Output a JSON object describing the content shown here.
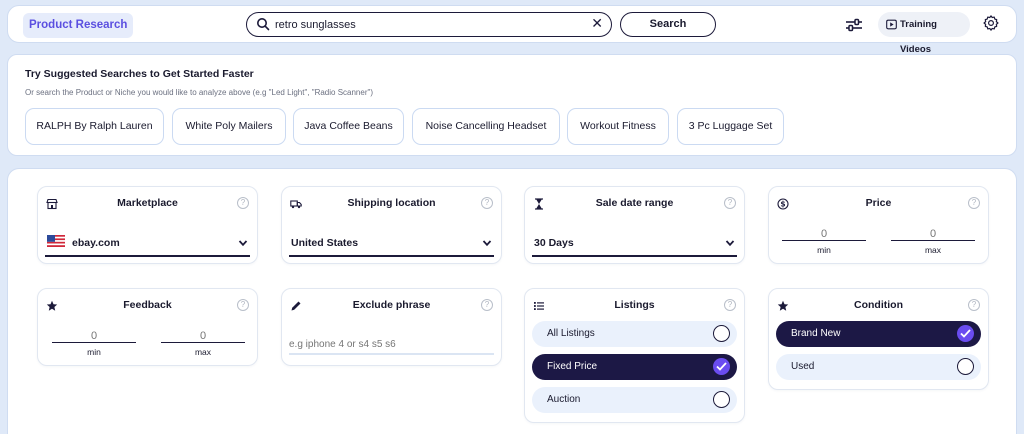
{
  "topbar": {
    "brand": "Product Research",
    "search_value": "retro sunglasses",
    "search_button": "Search",
    "training_videos": "Training Videos"
  },
  "suggested": {
    "title": "Try Suggested Searches to Get Started Faster",
    "subtitle": "Or search the Product or Niche you would like to analyze above (e.g \"Led Light\", \"Radio Scanner\")",
    "chips": [
      "RALPH By Ralph Lauren",
      "White Poly Mailers",
      "Java Coffee Beans",
      "Noise Cancelling Headset",
      "Workout Fitness",
      "3 Pc Luggage Set"
    ]
  },
  "filters": {
    "marketplace": {
      "title": "Marketplace",
      "value": "ebay.com"
    },
    "shipping": {
      "title": "Shipping location",
      "value": "United States"
    },
    "sale_date": {
      "title": "Sale date range",
      "value": "30 Days"
    },
    "price": {
      "title": "Price",
      "min_placeholder": "0",
      "max_placeholder": "0",
      "min_label": "min",
      "max_label": "max"
    },
    "feedback": {
      "title": "Feedback",
      "min_placeholder": "0",
      "max_placeholder": "0",
      "min_label": "min",
      "max_label": "max"
    },
    "exclude": {
      "title": "Exclude phrase",
      "placeholder": "e.g iphone 4 or s4 s5 s6"
    },
    "listings": {
      "title": "Listings",
      "options": [
        "All Listings",
        "Fixed Price",
        "Auction"
      ],
      "selected": "Fixed Price"
    },
    "condition": {
      "title": "Condition",
      "options": [
        "Brand New",
        "Used"
      ],
      "selected": "Brand New"
    },
    "help_glyph": "?"
  },
  "colors": {
    "accent": "#5b4fe0",
    "selected_bg": "#1c1845",
    "check": "#6a4cf0",
    "page_bg": "#dfe9f8"
  }
}
